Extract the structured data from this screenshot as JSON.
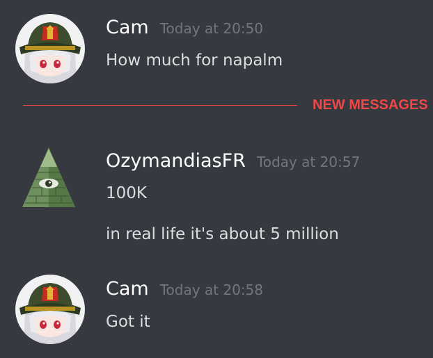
{
  "messages": [
    {
      "author": "Cam",
      "timestamp": "Today at 20:50",
      "lines": [
        "How much for napalm"
      ]
    },
    {
      "author": "OzymandiasFR",
      "timestamp": "Today at 20:57",
      "lines": [
        "100K",
        "in real life it's about 5 million"
      ]
    },
    {
      "author": "Cam",
      "timestamp": "Today at 20:58",
      "lines": [
        "Got it"
      ]
    }
  ],
  "divider": {
    "label": "NEW MESSAGES"
  },
  "colors": {
    "background": "#36393f",
    "username": "#ffffff",
    "timestamp": "#72767d",
    "message_text": "#dcddde",
    "new_messages_accent": "#f04747"
  }
}
